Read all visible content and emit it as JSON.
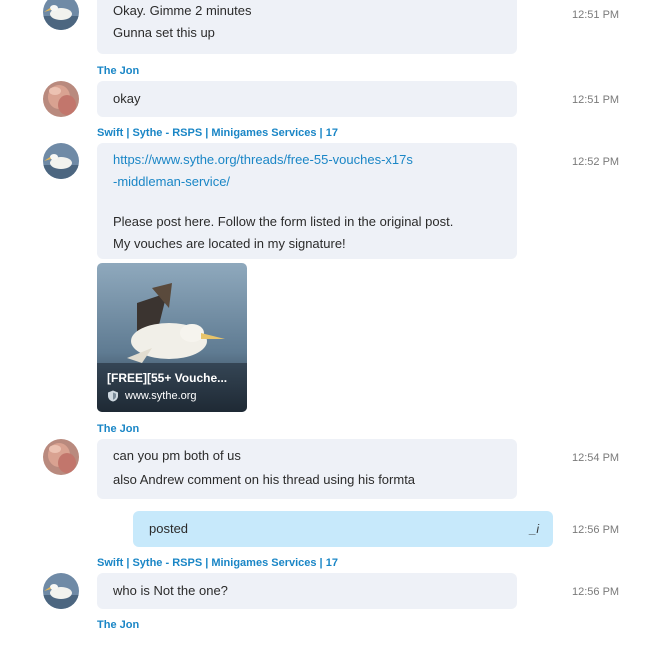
{
  "messages": {
    "m1": {
      "lines": [
        "Okay. Gimme 2 minutes",
        "Gunna set this up"
      ],
      "time": "12:51 PM"
    },
    "m2": {
      "sender": "The Jon",
      "lines": [
        "okay"
      ],
      "time": "12:51 PM"
    },
    "m3": {
      "sender": "Swift | Sythe - RSPS | Minigames Services | 17",
      "link_lines": [
        "https://www.sythe.org/threads/free-55-vouches-x17s",
        "-middleman-service/"
      ],
      "lines": [
        "Please post here. Follow the form listed in the original post.",
        "My vouches are located in my signature!"
      ],
      "time": "12:52 PM",
      "preview": {
        "title": "[FREE][55+ Vouche...",
        "site": "www.sythe.org"
      }
    },
    "m4": {
      "sender": "The Jon",
      "lines": [
        "can you pm both of us",
        "also Andrew comment on his thread using his formta"
      ],
      "time": "12:54 PM"
    },
    "m5": {
      "text": "posted",
      "edited_mark": "_i",
      "time": "12:56 PM"
    },
    "m6": {
      "sender": "Swift | Sythe - RSPS | Minigames Services | 17",
      "lines": [
        "who is Not the one?"
      ],
      "time": "12:56 PM"
    },
    "m7": {
      "sender": "The Jon"
    }
  },
  "colors": {
    "accent": "#1a86c6",
    "bubble": "#eef1f7",
    "own_bubble": "#c7e9fb"
  },
  "icons": {
    "avatar_pelican": "pelican-avatar",
    "avatar_jon": "user-photo-avatar",
    "site_shield": "shield-icon"
  }
}
